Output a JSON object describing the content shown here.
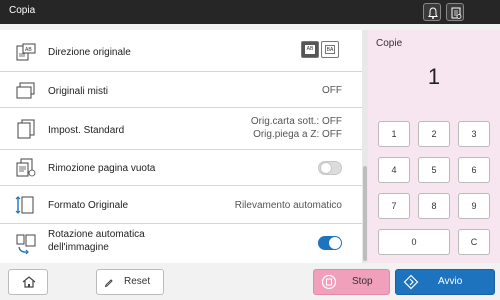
{
  "app": {
    "title": "Copia"
  },
  "topbar": {
    "icons": [
      "bell-icon",
      "device-status-icon"
    ]
  },
  "settings": {
    "rows": [
      {
        "label": "Direzione originale",
        "icon": "original-direction-icon",
        "options": [
          "AB",
          "BA"
        ]
      },
      {
        "label": "Originali misti",
        "icon": "mixed-originals-icon",
        "value": "OFF"
      },
      {
        "label": "Impost. Standard",
        "icon": "standard-settings-icon",
        "value_line1": "Orig.carta sott.: OFF",
        "value_line2": "Orig.piega a Z: OFF"
      },
      {
        "label": "Rimozione pagina vuota",
        "icon": "blank-page-removal-icon",
        "toggle": "off"
      },
      {
        "label": "Formato Originale",
        "icon": "original-size-icon",
        "value": "Rilevamento automatico"
      },
      {
        "label_line1": "Rotazione automatica",
        "label_line2": "dell'immagine",
        "icon": "auto-rotate-icon",
        "toggle": "on"
      }
    ]
  },
  "copies": {
    "label": "Copie",
    "value": "1"
  },
  "keypad": {
    "keys": [
      "1",
      "2",
      "3",
      "4",
      "5",
      "6",
      "7",
      "8",
      "9",
      "0",
      "C"
    ]
  },
  "bottombar": {
    "reset_label": "Reset",
    "stop_label": "Stop",
    "start_label": "Avvio"
  },
  "colors": {
    "accent": "#1e73be",
    "stop": "#f0a0ba",
    "keypad_bg": "#f7e6ef",
    "topbar": "#262626"
  }
}
